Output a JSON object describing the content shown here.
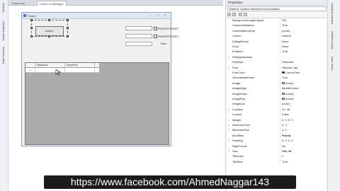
{
  "left_strip": {
    "tabs": [
      "Toolbox",
      "Server Explorer",
      "Data Sources"
    ]
  },
  "doc_tabs": [
    {
      "label": "Form1.cs*"
    },
    {
      "label": "Form1.cs [Design]*"
    }
  ],
  "form": {
    "title": "Form1",
    "button_text": "button1",
    "checkboxes": [
      "Keyword1 Expand",
      "Keyword2 Expand"
    ],
    "small_label": "Euler",
    "grid_columns": [
      "Keyword1",
      "Keyword2"
    ],
    "grid_row_marker": "*"
  },
  "properties": {
    "title": "Properties",
    "object": "Button1  System.Windows.Forms.Button",
    "rows": [
      {
        "name": "BackgroundImageLayout",
        "value": "Tile"
      },
      {
        "name": "CausesValidation",
        "value": "True"
      },
      {
        "name": "ContextMenuStrip",
        "value": "(none)"
      },
      {
        "name": "Cursor",
        "value": "Default"
      },
      {
        "name": "DialogResult",
        "value": "None"
      },
      {
        "name": "Dock",
        "value": "None"
      },
      {
        "name": "Enabled",
        "value": "True"
      },
      {
        "name": "FlatAppearance",
        "value": "",
        "expander": "+"
      },
      {
        "name": "FlatStyle",
        "value": "Standard"
      },
      {
        "name": "Font",
        "value": "Tahoma, 8pt",
        "expander": "+"
      },
      {
        "name": "ForeColor",
        "value": "ControlText",
        "swatch": "#000000"
      },
      {
        "name": "GenerateMember",
        "value": "True"
      },
      {
        "name": "Image",
        "value": "(none)",
        "swatch": "#ffffff"
      },
      {
        "name": "ImageAlign",
        "value": "MiddleCenter"
      },
      {
        "name": "ImageIndex",
        "value": "(none)",
        "swatch": "#ffffff"
      },
      {
        "name": "ImageKey",
        "value": "(none)",
        "swatch": "#ffffff"
      },
      {
        "name": "ImageList",
        "value": "(none)"
      },
      {
        "name": "Location",
        "value": "23, 48",
        "expander": "+"
      },
      {
        "name": "Locked",
        "value": "False"
      },
      {
        "name": "Margin",
        "value": "3, 3, 3, 3",
        "expander": "+"
      },
      {
        "name": "MaximumSize",
        "value": "0, 0",
        "expander": "+"
      },
      {
        "name": "MinimumSize",
        "value": "0, 0",
        "expander": "+"
      },
      {
        "name": "Modifiers",
        "value": "Friend",
        "bold": true
      },
      {
        "name": "Padding",
        "value": "0, 0, 0, 0",
        "expander": "+"
      },
      {
        "name": "RightToLeft",
        "value": "No"
      },
      {
        "name": "Size",
        "value": "144, 44",
        "expander": "+",
        "bold": true
      },
      {
        "name": "TabIndex",
        "value": "3"
      },
      {
        "name": "TabStop",
        "value": "True"
      }
    ]
  },
  "right_strip": {
    "tabs": [
      "Solution Explorer",
      "Team Explorer",
      "Class View"
    ]
  },
  "watermark": "https://www.facebook.com/AhmedNaggar143"
}
